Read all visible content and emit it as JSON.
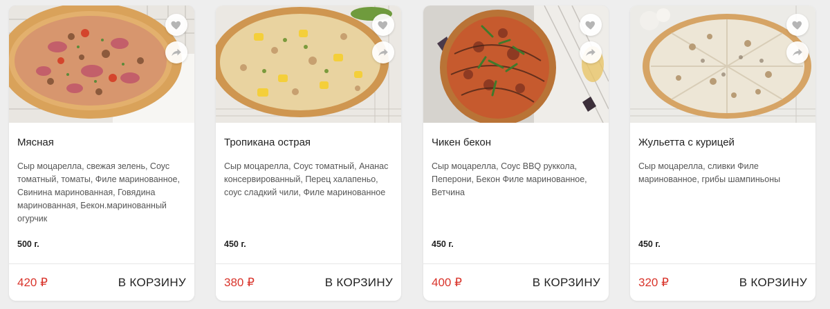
{
  "products": [
    {
      "name": "Мясная",
      "description": "Сыр моцарелла, свежая зелень, Соус томатный, томаты, Филе маринованное, Свинина маринованная, Говядина маринованная, Бекон.маринованный огурчик",
      "weight": "500 г.",
      "price": "420 ₽",
      "cart_label": "В КОРЗИНУ",
      "favorite_icon": "heart-icon",
      "share_icon": "share-icon"
    },
    {
      "name": "Тропикана острая",
      "description": "Сыр моцарелла, Соус томатный, Ананас консервированный, Перец халапеньо, соус сладкий чили, Филе маринованное",
      "weight": "450 г.",
      "price": "380 ₽",
      "cart_label": "В КОРЗИНУ",
      "favorite_icon": "heart-icon",
      "share_icon": "share-icon"
    },
    {
      "name": "Чикен бекон",
      "description": "Сыр моцарелла, Соус BBQ руккола, Пеперони, Бекон Филе маринованное, Ветчина",
      "weight": "450 г.",
      "price": "400 ₽",
      "cart_label": "В КОРЗИНУ",
      "favorite_icon": "heart-icon",
      "share_icon": "share-icon"
    },
    {
      "name": "Жульетта с курицей",
      "description": "Сыр моцарелла, сливки Филе маринованное, грибы шампиньоны",
      "weight": "450 г.",
      "price": "320 ₽",
      "cart_label": "В КОРЗИНУ",
      "favorite_icon": "heart-icon",
      "share_icon": "share-icon"
    }
  ],
  "colors": {
    "price": "#d9342b",
    "card_background": "#ffffff",
    "page_background": "#eeeeee",
    "icon": "#b5b5b5"
  }
}
